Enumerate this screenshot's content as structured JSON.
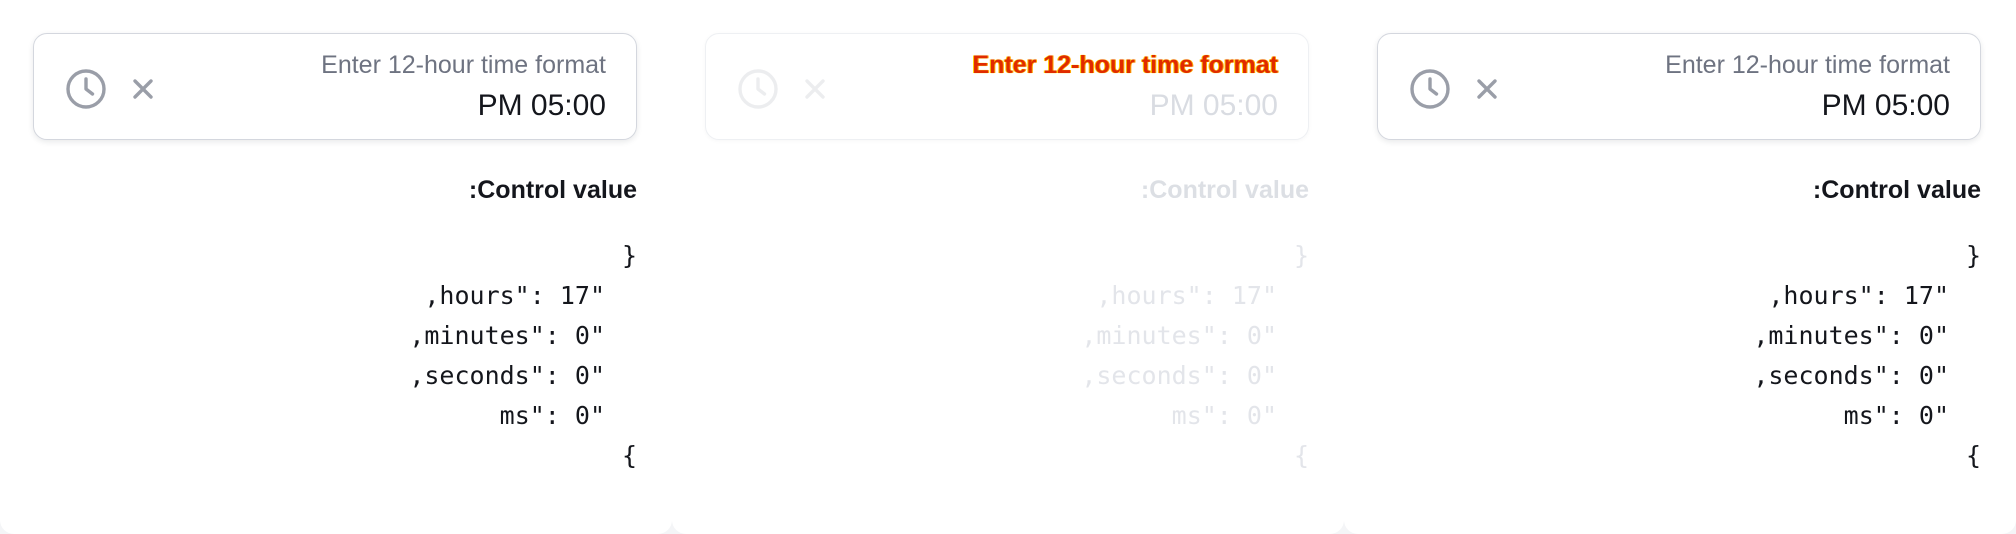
{
  "panels": [
    {
      "state": "normal",
      "time_field": {
        "placeholder": "Enter 12-hour time format",
        "value": "PM 05:00",
        "icons": [
          "clock-icon",
          "close-icon"
        ]
      },
      "control_label": ":Control value",
      "json_lines": [
        "}",
        ",hours\": 17\"",
        ",minutes\": 0\"",
        ",seconds\": 0\"",
        "ms\": 0\"",
        "{"
      ]
    },
    {
      "state": "disabled",
      "time_field": {
        "placeholder": "Enter 12-hour time format",
        "value": "PM 05:00",
        "icons": [
          "clock-icon",
          "close-icon"
        ]
      },
      "control_label": ":Control value",
      "json_lines": [
        "}",
        ",hours\": 17\"",
        ",minutes\": 0\"",
        ",seconds\": 0\"",
        "ms\": 0\"",
        "{"
      ]
    },
    {
      "state": "normal",
      "time_field": {
        "placeholder": "Enter 12-hour time format",
        "value": "PM 05:00",
        "icons": [
          "clock-icon",
          "close-icon"
        ]
      },
      "control_label": ":Control value",
      "json_lines": [
        "}",
        ",hours\": 17\"",
        ",minutes\": 0\"",
        ",seconds\": 0\"",
        "ms\": 0\"",
        "{"
      ]
    }
  ],
  "colors": {
    "text": "#14161c",
    "placeholder": "#6e7381",
    "icon": "#9a9ea8",
    "border": "#d4d7de",
    "disabled_placeholder": "#e02a00"
  }
}
